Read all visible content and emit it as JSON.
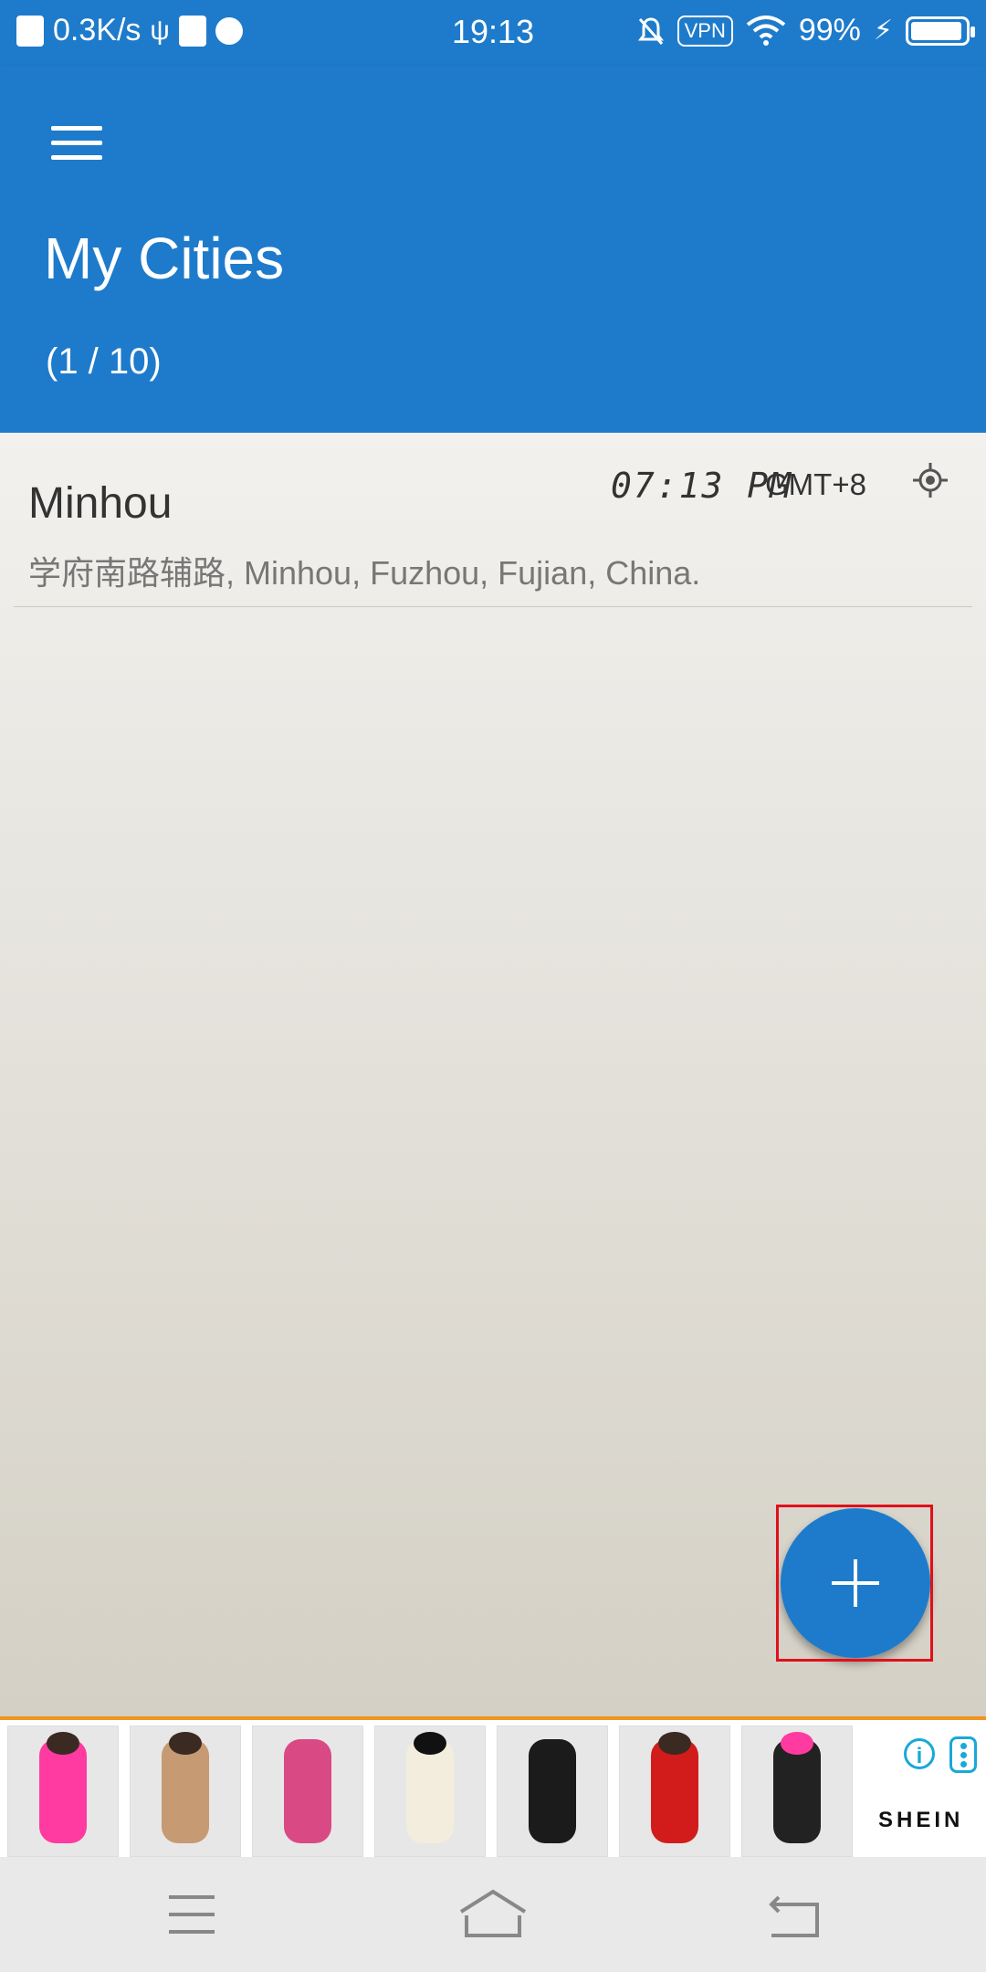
{
  "status_bar": {
    "net_speed": "0.3K/s",
    "time": "19:13",
    "vpn": "VPN",
    "battery": "99%"
  },
  "app_bar": {
    "title": "My Cities",
    "count": "(1 / 10)"
  },
  "cities": [
    {
      "name": "Minhou",
      "time": "07:13 PM",
      "timezone": "GMT+8",
      "address": "学府南路辅路, Minhou, Fuzhou, Fujian, China."
    }
  ],
  "fab": {
    "icon": "plus-icon"
  },
  "ad": {
    "brand": "SHEIN",
    "info_icon": "info-icon",
    "more_icon": "more-options-icon",
    "colors": {
      "accent_border": "#f0951f",
      "info": "#1aa8d8"
    }
  },
  "colors": {
    "primary": "#1e7bcb",
    "highlight_box": "#e0101a"
  },
  "nav": {
    "menu_icon": "menu-icon",
    "home_icon": "home-icon",
    "back_icon": "back-icon"
  }
}
